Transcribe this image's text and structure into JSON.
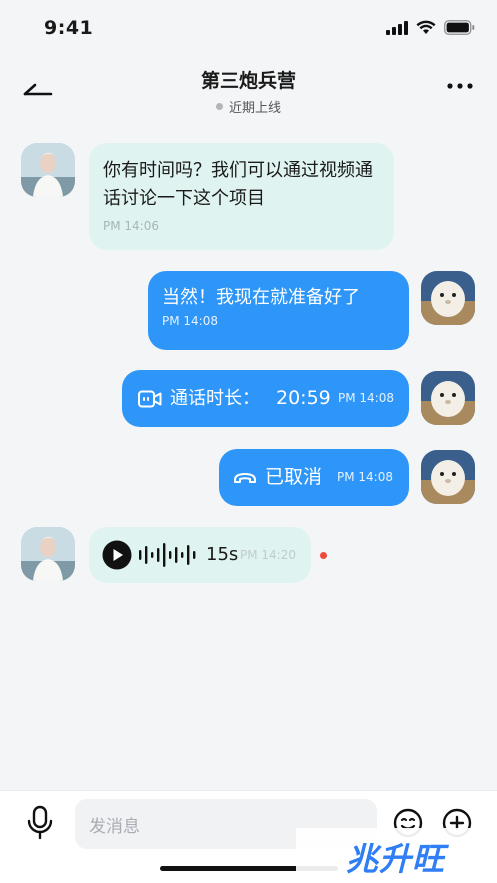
{
  "status": {
    "time": "9:41"
  },
  "header": {
    "title": "第三炮兵营",
    "subtitle": "近期上线"
  },
  "messages": [
    {
      "text": "你有时间吗？我们可以通过视频通话讨论一下这个项目",
      "time": "PM 14:06"
    },
    {
      "text": "当然！我现在就准备好了",
      "time": "PM 14:08"
    },
    {
      "label": "通话时长：",
      "duration": "20:59",
      "time": "PM 14:08"
    },
    {
      "label": "已取消",
      "time": "PM 14:08"
    },
    {
      "duration": "15s",
      "time": "PM 14:20"
    }
  ],
  "input": {
    "placeholder": "发消息"
  },
  "watermark": {
    "text": "兆升旺"
  },
  "colors": {
    "accent": "#2e96f8",
    "incoming": "#dff3f1",
    "unread": "#f04b3a"
  }
}
